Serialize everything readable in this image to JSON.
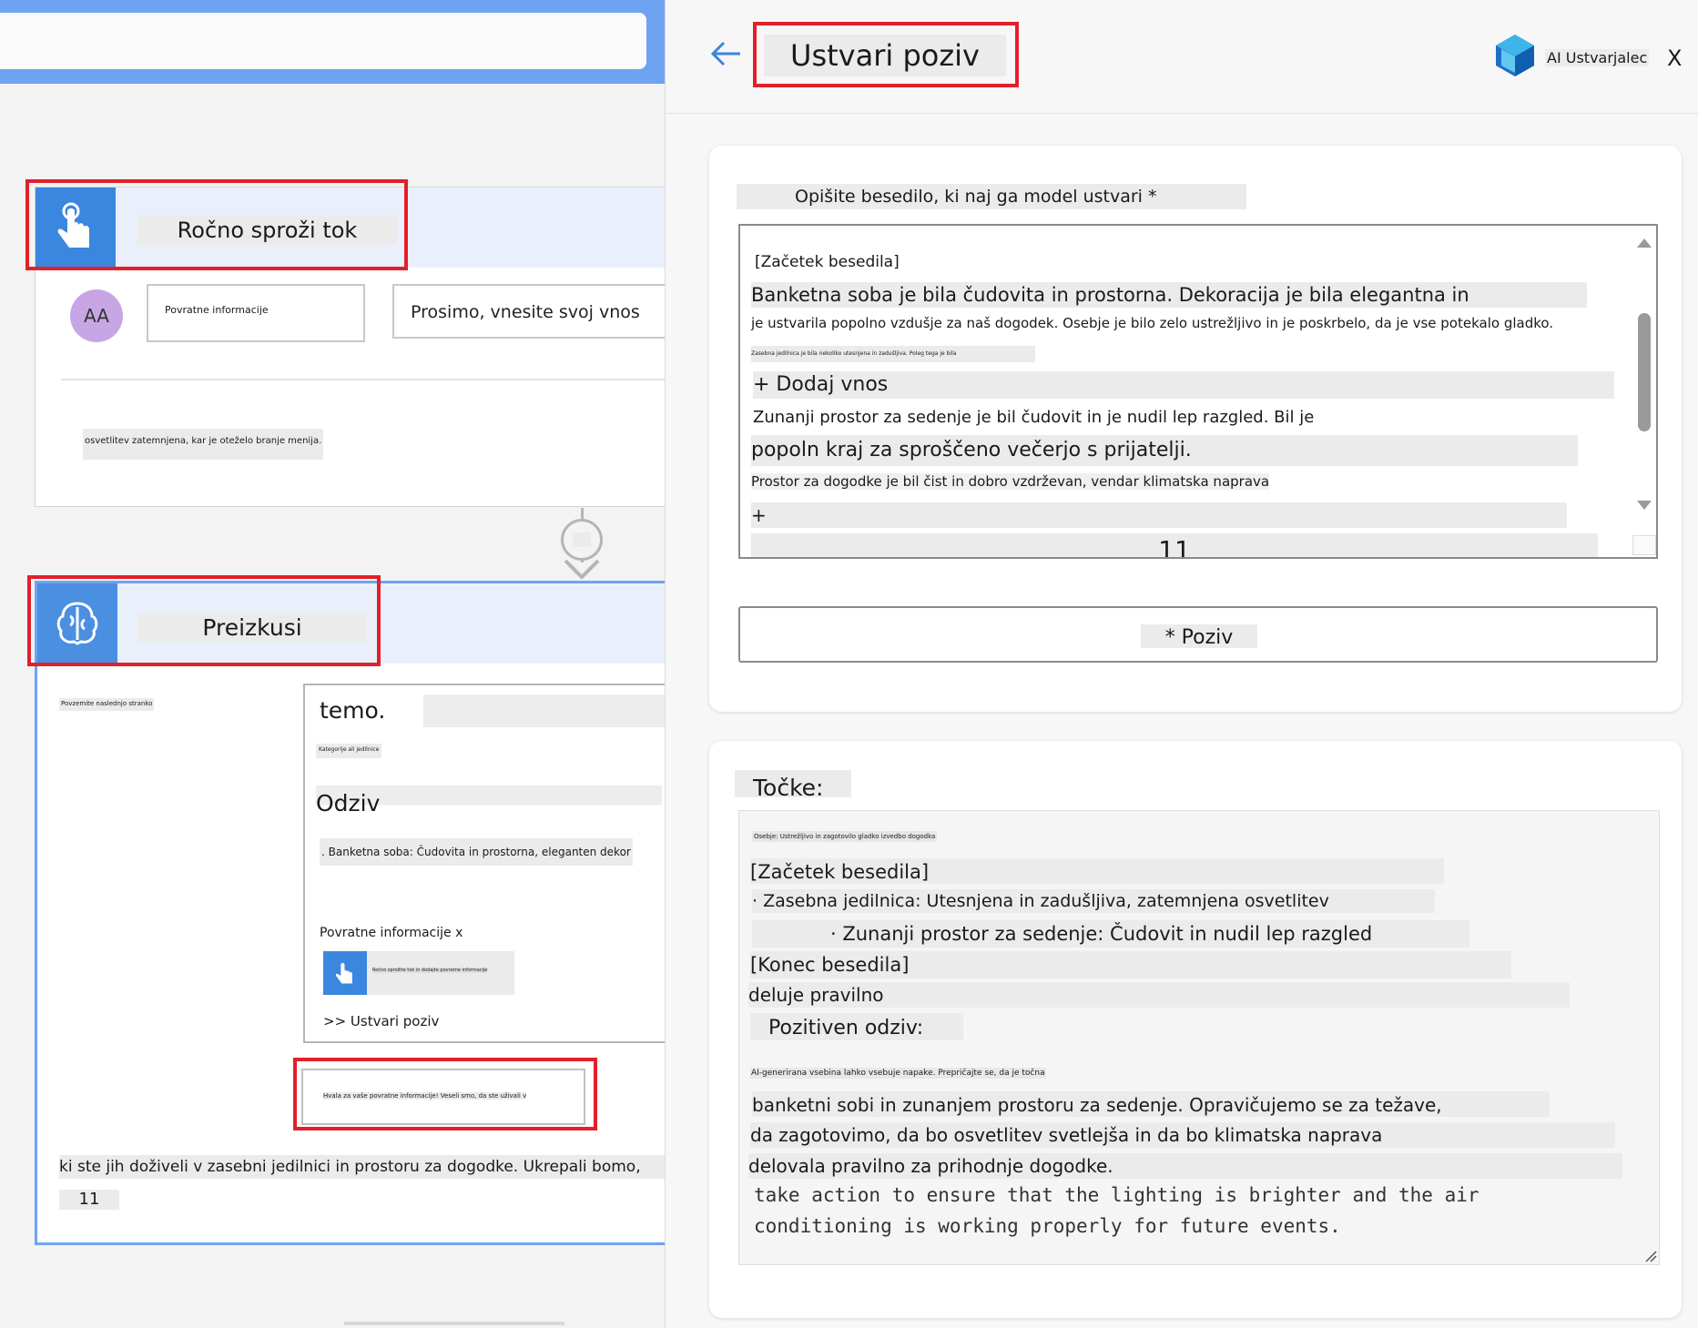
{
  "trigger_card": {
    "title": "Ročno sproži tok",
    "avatar": "AA",
    "field_label": "Povratne informacije",
    "field_placeholder": "Prosimo, vnesite svoj vnos",
    "snippet": "osvetlitev zatemnjena, kar je oteželo branje menija."
  },
  "try_card": {
    "title": "Preizkusi",
    "side_note": "Povzemite naslednjo stranko",
    "inner_heading": "temo.",
    "inner_small": "Kategorije ali jedilnice",
    "response_label": "Odziv",
    "response_text": ". Banketna soba: Čudovita in prostorna, eleganten dekor",
    "feedback_label": "Povratne informacije x",
    "chip_text": "Ročno sprožite tok in dodajte povratne informacije",
    "create_link": ">> Ustvari poziv",
    "thanks_text": "Hvala za vaše povratne informacije! Veseli smo, da ste uživali v",
    "bottom_text": "ki ste jih doživeli v zasebni jedilnici in prostoru za dogodke. Ukrepali bomo,",
    "bottom_count": "11"
  },
  "panel": {
    "title": "Ustvari poziv",
    "brand": "AI Ustvarjalec",
    "close": "X",
    "describe_label": "Opišite besedilo, ki naj ga model ustvari *",
    "prompt_lines": {
      "l1": "[Začetek besedila]",
      "l2": "Banketna soba je bila čudovita in prostorna. Dekoracija je bila elegantna in",
      "l3": "je ustvarila popolno vzdušje za naš dogodek. Osebje je bilo zelo ustrežljivo in je poskrbelo, da je vse potekalo gladko.",
      "l4": "Zasebna jedilnica je bila nekoliko utesnjena in zadušljiva. Poleg tega je bila",
      "l5": "+ Dodaj vnos",
      "l6": "Zunanji prostor za sedenje je bil čudovit in je nudil lep razgled. Bil je",
      "l7": "popoln kraj za sproščeno večerjo s prijatelji.",
      "l8": "Prostor za dogodke je bil čist in dobro vzdrževan, vendar klimatska naprava",
      "l9": "+",
      "l10": "11"
    },
    "prompt_button": "* Poziv",
    "output_label": "Točke:",
    "output_lines": {
      "o1": "Osebje: Ustrežljivo in zagotovilo gladko izvedbo dogodka",
      "o2": "[Začetek besedila]",
      "o3": "· Zasebna jedilnica: Utesnjena in zadušljiva, zatemnjena osvetlitev",
      "o4": "· Zunanji prostor za sedenje: Čudovit in nudil lep razgled",
      "o5": "[Konec besedila]",
      "o6": "deluje pravilno",
      "o7": "Pozitiven odziv:",
      "o8": "AI-generirana vsebina lahko vsebuje napake. Prepričajte se, da je točna",
      "o9": "banketni sobi in zunanjem prostoru za sedenje. Opravičujemo se za težave,",
      "o10": "da zagotovimo, da bo osvetlitev svetlejša in da bo klimatska naprava",
      "o11": "delovala pravilno za prihodnje dogodke.",
      "o12": "take action to ensure that the lighting is brighter and the air",
      "o13": "conditioning is working properly for future events."
    }
  },
  "colors": {
    "accent": "#3b86df",
    "highlight_red": "#e2202a",
    "topbar": "#6ea3f2"
  }
}
